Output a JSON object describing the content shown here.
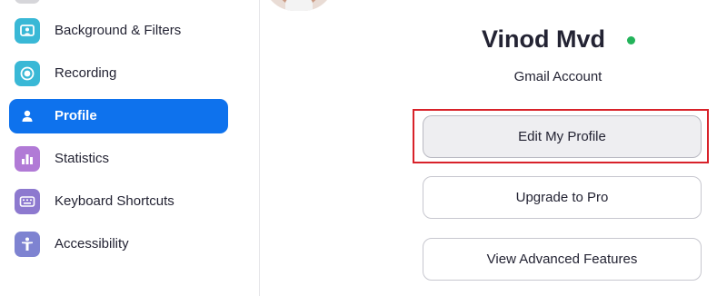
{
  "sidebar": {
    "items": [
      {
        "label": "Background & Filters",
        "icon": "background-filters-icon",
        "color": "#39b8d6"
      },
      {
        "label": "Recording",
        "icon": "recording-icon",
        "color": "#39b8d6"
      },
      {
        "label": "Profile",
        "icon": "profile-icon",
        "color": "#0e72ed",
        "active": true
      },
      {
        "label": "Statistics",
        "icon": "statistics-icon",
        "color": "#b17ad6"
      },
      {
        "label": "Keyboard Shortcuts",
        "icon": "keyboard-icon",
        "color": "#8d79cf"
      },
      {
        "label": "Accessibility",
        "icon": "accessibility-icon",
        "color": "#7e83d1"
      }
    ]
  },
  "profile": {
    "name": "Vinod Mvd",
    "account_type": "Gmail Account",
    "status_color": "#23b35a"
  },
  "buttons": {
    "edit_profile": "Edit My Profile",
    "upgrade": "Upgrade to Pro",
    "advanced": "View Advanced Features"
  },
  "colors": {
    "accent": "#0e72ed",
    "highlight": "#d8222a"
  }
}
